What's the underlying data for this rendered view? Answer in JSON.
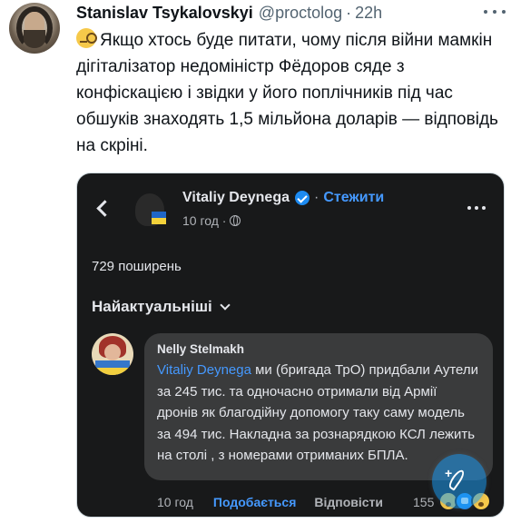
{
  "tweet": {
    "author_name": "Stanislav Tsykalovskyi",
    "handle": "@proctolog",
    "separator": "·",
    "time": "22h",
    "emoji": "monocle-face-icon",
    "text": "Якщо хтось буде питати, чому після війни мамкін дігіталізатор недоміністр Фёдоров сяде з конфіскацією і звідки у його поплічників під час обшуків знаходять 1,5 мільйона доларів — відповідь на скріні."
  },
  "screenshot": {
    "page_name": "Vitaliy Deynega",
    "dot": "·",
    "follow_label": "Стежити",
    "post_time": "10 год ·",
    "shares": "729 поширень",
    "sort_label": "Найактуальніші",
    "comment": {
      "author": "Nelly  Stelmakh",
      "mention": "Vitaliy Deynega",
      "text": " ми  (бригада ТрО) придбали Аутели за 245 тис. та одночасно отримали від Армії дронів як благодійну допомогу таку саму модель за 494 тис. Накладна за рознарядкою КСЛ лежить на столі , з номерами отриманих БПЛА.",
      "time": "10 год",
      "like_label": "Подобається",
      "reply_label": "Відповісти",
      "reaction_count": "155",
      "reactions": [
        "wow-emoji-icon",
        "like-emoji-icon",
        "sad-emoji-icon"
      ]
    }
  },
  "colors": {
    "link_blue": "#4599ff",
    "dark_bg": "#18191a",
    "bubble_bg": "#3a3b3c",
    "twitter_blue": "#1d9bf0"
  }
}
